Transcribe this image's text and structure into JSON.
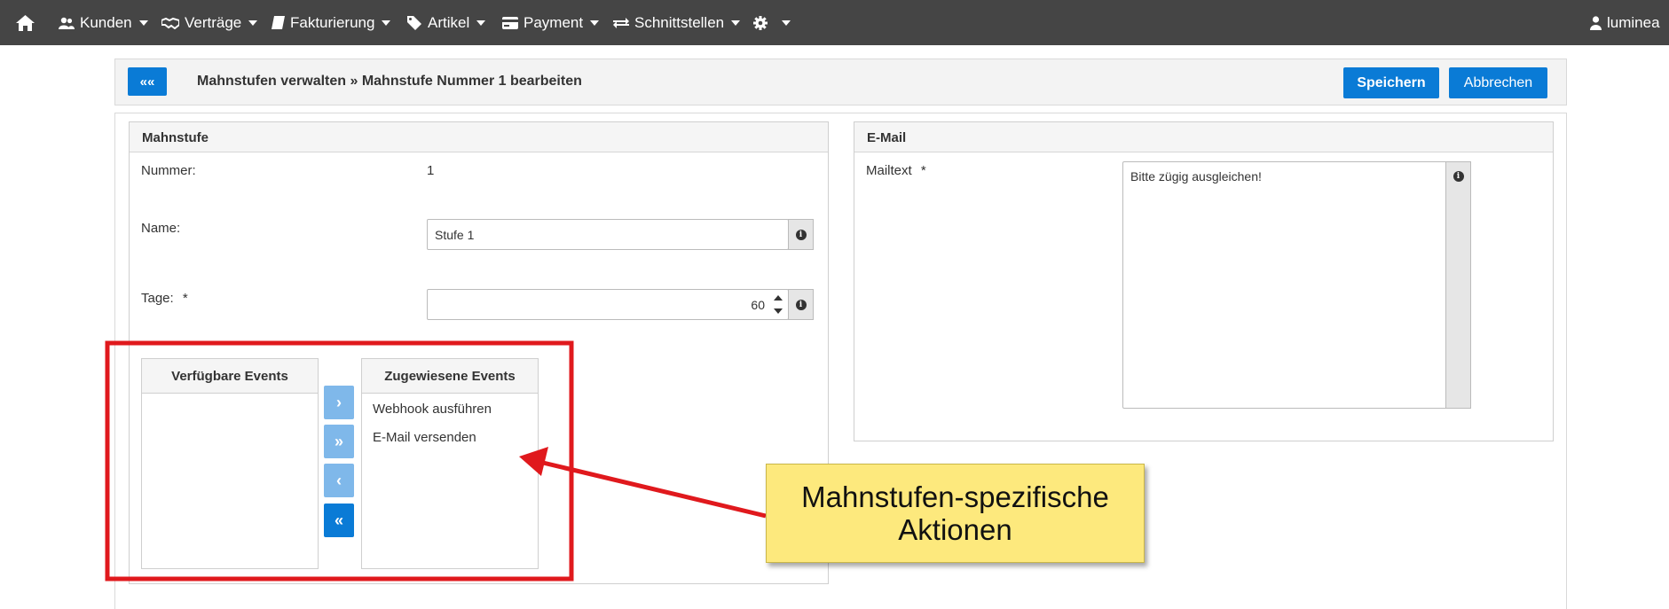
{
  "navbar": {
    "items": [
      {
        "label": "Kunden",
        "icon": "users-icon"
      },
      {
        "label": "Verträge",
        "icon": "handshake-icon"
      },
      {
        "label": "Fakturierung",
        "icon": "book-icon"
      },
      {
        "label": "Artikel",
        "icon": "tags-icon"
      },
      {
        "label": "Payment",
        "icon": "credit-card-icon"
      },
      {
        "label": "Schnittstellen",
        "icon": "exchange-icon"
      }
    ],
    "user": "luminea"
  },
  "header": {
    "back_label": "««",
    "title": "Mahnstufen verwalten » Mahnstufe Nummer 1 bearbeiten",
    "save_label": "Speichern",
    "cancel_label": "Abbrechen"
  },
  "mahnstufe": {
    "title": "Mahnstufe",
    "nummer_label": "Nummer:",
    "nummer_value": "1",
    "name_label": "Name:",
    "name_value": "Stufe 1",
    "tage_label": "Tage:",
    "tage_required": "*",
    "tage_value": "60"
  },
  "events": {
    "available_title": "Verfügbare Events",
    "assigned_title": "Zugewiesene Events",
    "assigned_items": [
      "Webhook ausführen",
      "E-Mail versenden"
    ],
    "buttons": [
      "›",
      "»",
      "‹",
      "«"
    ]
  },
  "email": {
    "title": "E-Mail",
    "mailtext_label": "Mailtext",
    "mailtext_required": "*",
    "mailtext_value": "Bitte zügig ausgleichen!"
  },
  "annotation": {
    "text": "Mahnstufen-spezifische\nAktionen",
    "color": "#e0191d"
  },
  "colors": {
    "navbar_bg": "#454545",
    "primary": "#0a7bd6",
    "button_light": "#7fb8ea",
    "callout_bg": "#fde97d"
  }
}
